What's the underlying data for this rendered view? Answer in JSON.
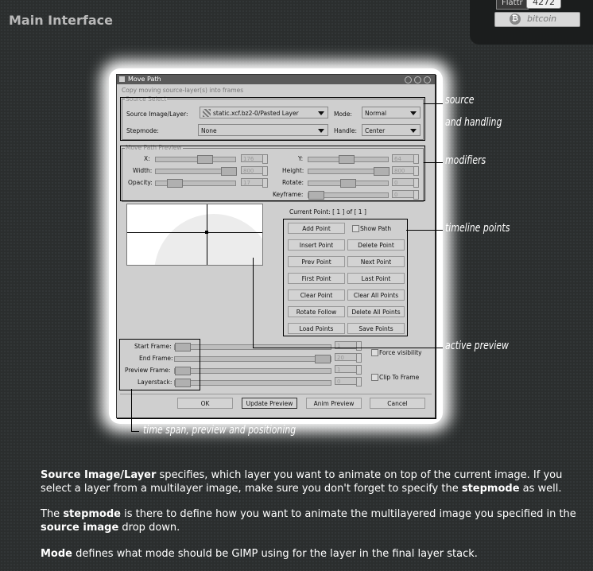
{
  "page_title": "Main Interface",
  "badges": {
    "flattr_label": "Flattr",
    "flattr_count": "4272",
    "bitcoin_label": "bitcoin"
  },
  "window": {
    "title": "Move Path",
    "subtitle": "Copy moving source-layer(s) into frames",
    "source_select": {
      "group_label": "Source Select",
      "source_label": "Source Image/Layer:",
      "source_value": "static.xcf.bz2-0/Pasted Layer",
      "mode_label": "Mode:",
      "mode_value": "Normal",
      "stepmode_label": "Stepmode:",
      "stepmode_value": "None",
      "handle_label": "Handle:",
      "handle_value": "Center"
    },
    "move_path": {
      "group_label": "Move Path Preview",
      "x_label": "X:",
      "x_value": "176",
      "y_label": "Y:",
      "y_value": "64",
      "width_label": "Width:",
      "width_value": "800",
      "height_label": "Height:",
      "height_value": "800",
      "opacity_label": "Opacity:",
      "opacity_value": "17",
      "rotate_label": "Rotate:",
      "rotate_value": "0",
      "keyframe_label": "Keyframe:",
      "keyframe_value": "0"
    },
    "current_point": "Current Point: [ 1 ] of [ 1 ]",
    "point_buttons": {
      "add": "Add Point",
      "show_path": "Show Path",
      "insert": "Insert Point",
      "delete": "Delete Point",
      "prev": "Prev Point",
      "next": "Next Point",
      "first": "First Point",
      "last": "Last Point",
      "clear": "Clear Point",
      "clear_all": "Clear All Points",
      "rotate_follow": "Rotate Follow",
      "delete_all": "Delete All Points",
      "load": "Load Points",
      "save": "Save Points"
    },
    "frames": {
      "start_label": "Start Frame:",
      "start_value": "1",
      "end_label": "End Frame:",
      "end_value": "20",
      "preview_label": "Preview Frame:",
      "preview_value": "1",
      "layerstack_label": "Layerstack:",
      "layerstack_value": "0",
      "force_visibility": "Force visibility",
      "clip_to_frame": "Clip To Frame"
    },
    "buttons": {
      "ok": "OK",
      "update_preview": "Update Preview",
      "anim_preview": "Anim Preview",
      "cancel": "Cancel"
    }
  },
  "annotations": {
    "source_line1": "source",
    "source_line2": "and handling",
    "modifiers": "modifiers",
    "timeline": "timeline points",
    "active_preview": "active preview",
    "time_span": "time span, preview and positioning"
  },
  "description": {
    "p1_b1": "Source Image/Layer",
    "p1_t1": " specifies, which layer you want to animate on top of the current image. If you select a layer from a multilayer image, make sure you don't forget to specify the ",
    "p1_b2": "stepmode",
    "p1_t2": " as well.",
    "p2_t1": "The ",
    "p2_b1": "stepmode",
    "p2_t2": " is there to define how you want to animate the multilayered image you specified in the ",
    "p2_b2": "source image",
    "p2_t3": " drop down.",
    "p3_b1": "Mode",
    "p3_t1": " defines what mode should be GIMP using for the layer in the final layer stack."
  }
}
